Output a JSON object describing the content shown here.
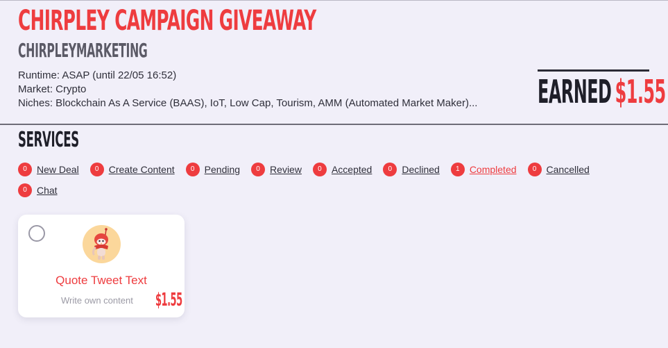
{
  "campaign": {
    "title": "CHIRPLEY CAMPAIGN GIVEAWAY",
    "brand": "CHIRPLEYMARKETING",
    "runtime": "Runtime: ASAP (until 22/05 16:52)",
    "market": "Market: Crypto",
    "niches": "Niches: Blockchain As A Service (BAAS), IoT, Low Cap, Tourism, AMM (Automated Market Maker)..."
  },
  "earned": {
    "label": "EARNED",
    "value": "$1.55"
  },
  "services": {
    "title": "SERVICES",
    "filters": [
      {
        "count": "0",
        "label": "New Deal",
        "active": false
      },
      {
        "count": "0",
        "label": "Create Content",
        "active": false
      },
      {
        "count": "0",
        "label": "Pending",
        "active": false
      },
      {
        "count": "0",
        "label": "Review",
        "active": false
      },
      {
        "count": "0",
        "label": "Accepted",
        "active": false
      },
      {
        "count": "0",
        "label": "Declined",
        "active": false
      },
      {
        "count": "1",
        "label": "Completed",
        "active": true
      },
      {
        "count": "0",
        "label": "Cancelled",
        "active": false
      },
      {
        "count": "0",
        "label": "Chat",
        "active": false
      }
    ]
  },
  "card": {
    "title": "Quote Tweet Text",
    "subtitle": "Write own content",
    "price": "$1.55",
    "avatar_icon": "chirpley-mascot-icon"
  },
  "colors": {
    "accent": "#ee3c3f",
    "background": "#f1eff9",
    "text": "#2b2b36"
  }
}
